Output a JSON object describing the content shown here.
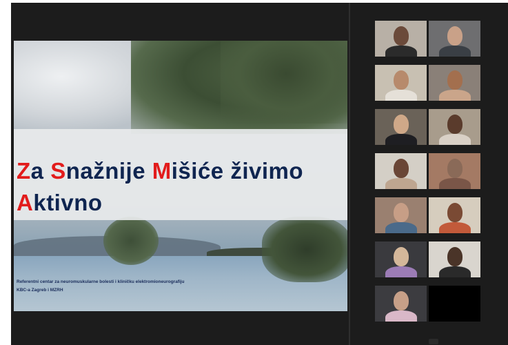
{
  "slide": {
    "title_line1": [
      {
        "cap": "Z",
        "rest": "a "
      },
      {
        "cap": "S",
        "rest": "nažnije "
      },
      {
        "cap": "M",
        "rest": "išiće živimo"
      }
    ],
    "title_line2": {
      "cap": "A",
      "rest": "ktivno"
    },
    "footer_line1": "Referentni centar za neuromuskularne bolesti i kliničku elektromioneurografiju",
    "footer_line2": "KBC-a Zagreb i MZRH"
  },
  "participants": [
    {
      "name": "",
      "head": "#6b4a3a",
      "body": "#2b2b2b",
      "bg": "#b8b0a6"
    },
    {
      "name": "",
      "head": "#c9a188",
      "body": "#3a3f45",
      "bg": "#6e6e70"
    },
    {
      "name": "",
      "head": "#b78a6c",
      "body": "#e5e0d8",
      "bg": "#c8c0b2",
      "active": true
    },
    {
      "name": "",
      "head": "#a36f4e",
      "body": "#caa58a",
      "bg": "#8a8078"
    },
    {
      "name": "",
      "head": "#cfa888",
      "body": "#1e1e22",
      "bg": "#6a6258"
    },
    {
      "name": "",
      "head": "#5a3b2c",
      "body": "#d9d0c6",
      "bg": "#a89c8c"
    },
    {
      "name": "",
      "head": "#6a4636",
      "body": "#bfa690",
      "bg": "#d4cfc6"
    },
    {
      "name": "",
      "head": "#8a6a58",
      "body": "#7a5648",
      "bg": "#a47a64"
    },
    {
      "name": "",
      "head": "#c79e86",
      "body": "#4a6a8a",
      "bg": "#9a8070"
    },
    {
      "name": "",
      "head": "#7a4a34",
      "body": "#c25a3a",
      "bg": "#d6cdbe"
    },
    {
      "name": "",
      "head": "#d4b79a",
      "body": "#9c7cb6",
      "bg": "#3a3a3e"
    },
    {
      "name": "",
      "head": "#4a3428",
      "body": "#2a2a2a",
      "bg": "#d9d5ce"
    },
    {
      "name": "",
      "head": "#c7a088",
      "body": "#d9b8c8",
      "bg": "#3c3c40"
    },
    {
      "name": "",
      "head": "",
      "body": "",
      "bg": "#000000",
      "black": true
    }
  ]
}
